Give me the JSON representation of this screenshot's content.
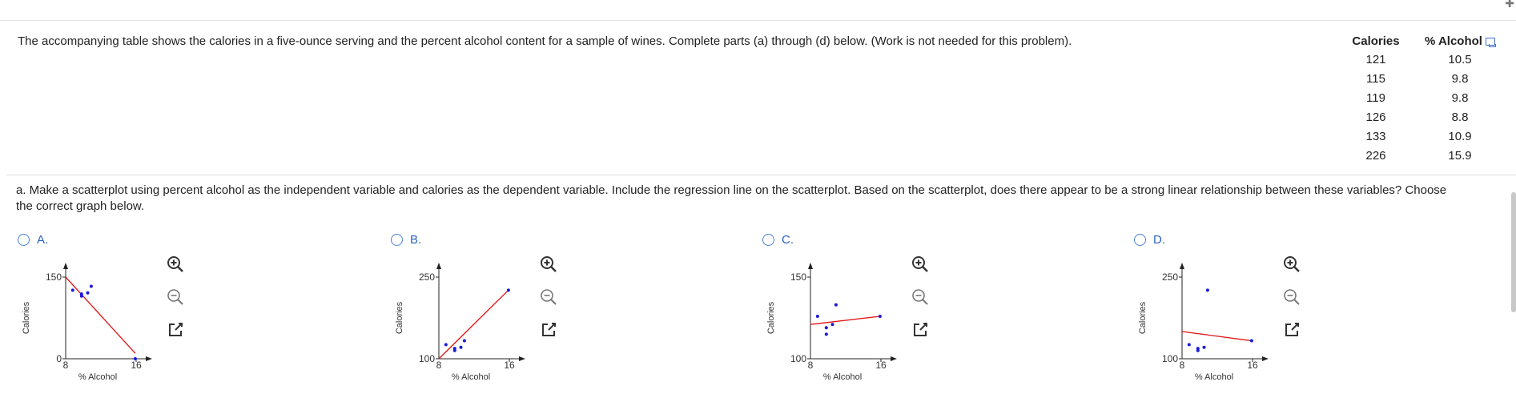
{
  "intro_text": "The accompanying table shows the calories in a five-ounce serving and the percent alcohol content for a sample of wines. Complete parts (a) through (d) below. (Work is not needed for this problem).",
  "table": {
    "headers": [
      "Calories",
      "% Alcohol"
    ],
    "rows": [
      [
        "121",
        "10.5"
      ],
      [
        "115",
        "9.8"
      ],
      [
        "119",
        "9.8"
      ],
      [
        "126",
        "8.8"
      ],
      [
        "133",
        "10.9"
      ],
      [
        "226",
        "15.9"
      ]
    ],
    "copy_icon": "copy-icon"
  },
  "question_text": "a. Make a scatterplot using percent alcohol as the independent variable and calories as the dependent variable. Include the regression line on the scatterplot. Based on the scatterplot, does there appear to be a strong linear relationship between these variables? Choose the correct graph below.",
  "colors": {
    "accent": "#2a63c2",
    "points": "#1a1adb",
    "line": "#e01010"
  },
  "options": [
    {
      "letter": "A.",
      "ylabel": "Calories",
      "xlabel": "% Alcohol",
      "y_top": "150",
      "y_bottom": "0",
      "x_min": "8",
      "x_max": "16",
      "icons": [
        "zoom-in-icon",
        "zoom-out-icon",
        "popout-icon"
      ]
    },
    {
      "letter": "B.",
      "ylabel": "Calories",
      "xlabel": "% Alcohol",
      "y_top": "250",
      "y_bottom": "100",
      "x_min": "8",
      "x_max": "16",
      "icons": [
        "zoom-in-icon",
        "zoom-out-icon",
        "popout-icon"
      ]
    },
    {
      "letter": "C.",
      "ylabel": "Calories",
      "xlabel": "% Alcohol",
      "y_top": "150",
      "y_bottom": "100",
      "x_min": "8",
      "x_max": "16",
      "icons": [
        "zoom-in-icon",
        "zoom-out-icon",
        "popout-icon"
      ]
    },
    {
      "letter": "D.",
      "ylabel": "Calories",
      "xlabel": "% Alcohol",
      "y_top": "250",
      "y_bottom": "100",
      "x_min": "8",
      "x_max": "16",
      "icons": [
        "zoom-in-icon",
        "zoom-out-icon",
        "popout-icon"
      ]
    }
  ],
  "chart_data": [
    {
      "type": "scatter",
      "xlabel": "% Alcohol",
      "ylabel": "Calories",
      "xlim": [
        8,
        16
      ],
      "ylim": [
        0,
        150
      ],
      "points": [
        [
          8.8,
          126
        ],
        [
          9.8,
          115
        ],
        [
          9.8,
          119
        ],
        [
          10.5,
          121
        ],
        [
          10.9,
          133
        ],
        [
          15.9,
          0
        ]
      ],
      "regression_line": [
        [
          8,
          150
        ],
        [
          15.9,
          10
        ]
      ]
    },
    {
      "type": "scatter",
      "xlabel": "% Alcohol",
      "ylabel": "Calories",
      "xlim": [
        8,
        16
      ],
      "ylim": [
        100,
        250
      ],
      "points": [
        [
          8.8,
          126
        ],
        [
          9.8,
          115
        ],
        [
          9.8,
          119
        ],
        [
          10.5,
          121
        ],
        [
          10.9,
          133
        ],
        [
          15.9,
          226
        ]
      ],
      "regression_line": [
        [
          8,
          100
        ],
        [
          15.9,
          226
        ]
      ]
    },
    {
      "type": "scatter",
      "xlabel": "% Alcohol",
      "ylabel": "Calories",
      "xlim": [
        8,
        16
      ],
      "ylim": [
        100,
        150
      ],
      "points": [
        [
          8.8,
          126
        ],
        [
          9.8,
          115
        ],
        [
          9.8,
          119
        ],
        [
          10.5,
          121
        ],
        [
          10.9,
          133
        ],
        [
          15.9,
          126
        ]
      ],
      "regression_line": [
        [
          8,
          121
        ],
        [
          15.9,
          126
        ]
      ]
    },
    {
      "type": "scatter",
      "xlabel": "% Alcohol",
      "ylabel": "Calories",
      "xlim": [
        8,
        16
      ],
      "ylim": [
        100,
        250
      ],
      "points": [
        [
          8.8,
          126
        ],
        [
          9.8,
          115
        ],
        [
          9.8,
          119
        ],
        [
          10.5,
          121
        ],
        [
          10.9,
          226
        ],
        [
          15.9,
          133
        ]
      ],
      "regression_line": [
        [
          8,
          150
        ],
        [
          15.9,
          133
        ]
      ]
    }
  ]
}
